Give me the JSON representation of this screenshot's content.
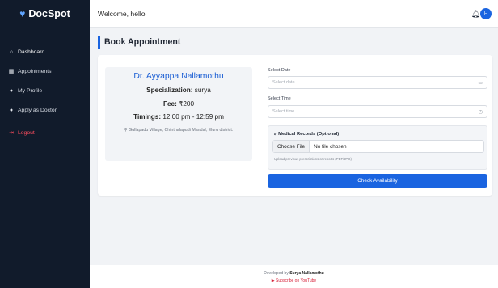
{
  "app": {
    "name": "DocSpot",
    "logo_icon": "heart-icon",
    "accent": "#1a64e0"
  },
  "sidebar": {
    "items": [
      {
        "label": "Dashboard",
        "icon": "home-icon"
      },
      {
        "label": "Appointments",
        "icon": "calendar-icon"
      },
      {
        "label": "My Profile",
        "icon": "user-icon"
      },
      {
        "label": "Apply as Doctor",
        "icon": "user-plus-icon"
      },
      {
        "label": "Logout",
        "icon": "logout-icon"
      }
    ]
  },
  "header": {
    "welcome": "Welcome, hello",
    "avatar_initial": "H"
  },
  "page": {
    "title": "Book Appointment"
  },
  "doctor": {
    "name": "Dr. Ayyappa Nallamothu",
    "specialization_label": "Specialization:",
    "specialization": "surya",
    "fee_label": "Fee:",
    "fee": "₹200",
    "timings_label": "Timings:",
    "timings": "12:00 pm - 12:59 pm",
    "address": "Gullapadu Village, Chinthalapudi Mandal, Eluru district."
  },
  "form": {
    "date_label": "Select Date",
    "date_placeholder": "Select date",
    "time_label": "Select Time",
    "time_placeholder": "Select time",
    "medical_title": "Medical Records (Optional)",
    "choose_file": "Choose File",
    "file_status": "No file chosen",
    "medical_help": "Upload previous prescriptions or reports (PDF/JPG)",
    "submit_label": "Check Availability"
  },
  "footer": {
    "developed_prefix": "Developed by",
    "developer": "Surya Nallamothu",
    "subscribe": "Subscribe on YouTube"
  }
}
